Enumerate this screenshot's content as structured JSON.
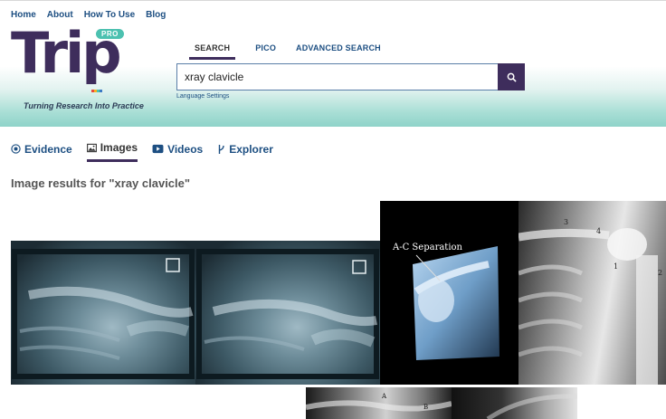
{
  "topnav": {
    "items": [
      "Home",
      "About",
      "How To Use",
      "Blog"
    ]
  },
  "logo": {
    "wordmark": "Trip",
    "badge": "PRO",
    "tagline": "Turning Research Into Practice",
    "brand_color": "#3e2d5c",
    "accent_color": "#4cc1b0"
  },
  "search": {
    "tabs": [
      "SEARCH",
      "PICO",
      "ADVANCED SEARCH"
    ],
    "active_tab": "SEARCH",
    "value": "xray clavicle",
    "button_icon": "search-icon",
    "language_link": "Language Settings"
  },
  "result_tabs": [
    {
      "label": "Evidence",
      "icon": "target-icon"
    },
    {
      "label": "Images",
      "icon": "image-icon",
      "active": true
    },
    {
      "label": "Videos",
      "icon": "play-icon"
    },
    {
      "label": "Explorer",
      "icon": "branch-icon"
    }
  ],
  "results": {
    "heading": "Image results for \"xray clavicle\""
  },
  "thumbnails": [
    {
      "annotation": "",
      "subject": "clavicle x-ray 1"
    },
    {
      "annotation": "",
      "subject": "clavicle x-ray 2"
    },
    {
      "annotation": "A-C Separation",
      "subject": "shoulder x-ray"
    },
    {
      "annotation": "",
      "subject": "shoulder anatomy x-ray",
      "labels": [
        "1",
        "2",
        "3",
        "4"
      ]
    },
    {
      "annotation": "",
      "subject": "clavicle x-ray 5",
      "labels": [
        "A",
        "B"
      ]
    },
    {
      "annotation": "",
      "subject": "clavicle x-ray 6"
    }
  ]
}
